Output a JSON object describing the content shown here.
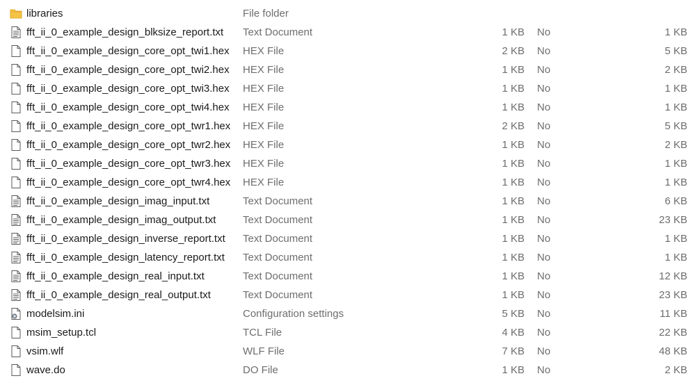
{
  "files": [
    {
      "name": "libraries",
      "type": "File folder",
      "size": "",
      "compressed": "",
      "original": "",
      "icon": "folder-icon"
    },
    {
      "name": "fft_ii_0_example_design_blksize_report.txt",
      "type": "Text Document",
      "size": "1 KB",
      "compressed": "No",
      "original": "1 KB",
      "icon": "text-file-icon"
    },
    {
      "name": "fft_ii_0_example_design_core_opt_twi1.hex",
      "type": "HEX File",
      "size": "2 KB",
      "compressed": "No",
      "original": "5 KB",
      "icon": "file-icon"
    },
    {
      "name": "fft_ii_0_example_design_core_opt_twi2.hex",
      "type": "HEX File",
      "size": "1 KB",
      "compressed": "No",
      "original": "2 KB",
      "icon": "file-icon"
    },
    {
      "name": "fft_ii_0_example_design_core_opt_twi3.hex",
      "type": "HEX File",
      "size": "1 KB",
      "compressed": "No",
      "original": "1 KB",
      "icon": "file-icon"
    },
    {
      "name": "fft_ii_0_example_design_core_opt_twi4.hex",
      "type": "HEX File",
      "size": "1 KB",
      "compressed": "No",
      "original": "1 KB",
      "icon": "file-icon"
    },
    {
      "name": "fft_ii_0_example_design_core_opt_twr1.hex",
      "type": "HEX File",
      "size": "2 KB",
      "compressed": "No",
      "original": "5 KB",
      "icon": "file-icon"
    },
    {
      "name": "fft_ii_0_example_design_core_opt_twr2.hex",
      "type": "HEX File",
      "size": "1 KB",
      "compressed": "No",
      "original": "2 KB",
      "icon": "file-icon"
    },
    {
      "name": "fft_ii_0_example_design_core_opt_twr3.hex",
      "type": "HEX File",
      "size": "1 KB",
      "compressed": "No",
      "original": "1 KB",
      "icon": "file-icon"
    },
    {
      "name": "fft_ii_0_example_design_core_opt_twr4.hex",
      "type": "HEX File",
      "size": "1 KB",
      "compressed": "No",
      "original": "1 KB",
      "icon": "file-icon"
    },
    {
      "name": "fft_ii_0_example_design_imag_input.txt",
      "type": "Text Document",
      "size": "1 KB",
      "compressed": "No",
      "original": "6 KB",
      "icon": "text-file-icon"
    },
    {
      "name": "fft_ii_0_example_design_imag_output.txt",
      "type": "Text Document",
      "size": "1 KB",
      "compressed": "No",
      "original": "23 KB",
      "icon": "text-file-icon"
    },
    {
      "name": "fft_ii_0_example_design_inverse_report.txt",
      "type": "Text Document",
      "size": "1 KB",
      "compressed": "No",
      "original": "1 KB",
      "icon": "text-file-icon"
    },
    {
      "name": "fft_ii_0_example_design_latency_report.txt",
      "type": "Text Document",
      "size": "1 KB",
      "compressed": "No",
      "original": "1 KB",
      "icon": "text-file-icon"
    },
    {
      "name": "fft_ii_0_example_design_real_input.txt",
      "type": "Text Document",
      "size": "1 KB",
      "compressed": "No",
      "original": "12 KB",
      "icon": "text-file-icon"
    },
    {
      "name": "fft_ii_0_example_design_real_output.txt",
      "type": "Text Document",
      "size": "1 KB",
      "compressed": "No",
      "original": "23 KB",
      "icon": "text-file-icon"
    },
    {
      "name": "modelsim.ini",
      "type": "Configuration settings",
      "size": "5 KB",
      "compressed": "No",
      "original": "11 KB",
      "icon": "settings-file-icon"
    },
    {
      "name": "msim_setup.tcl",
      "type": "TCL File",
      "size": "4 KB",
      "compressed": "No",
      "original": "22 KB",
      "icon": "file-icon"
    },
    {
      "name": "vsim.wlf",
      "type": "WLF File",
      "size": "7 KB",
      "compressed": "No",
      "original": "48 KB",
      "icon": "file-icon"
    },
    {
      "name": "wave.do",
      "type": "DO File",
      "size": "1 KB",
      "compressed": "No",
      "original": "2 KB",
      "icon": "file-icon"
    }
  ],
  "colors": {
    "folder": "#f6c445",
    "folder_dark": "#e0a82e",
    "file_outline": "#5a5a5a",
    "text_muted": "#6d6d6d"
  }
}
